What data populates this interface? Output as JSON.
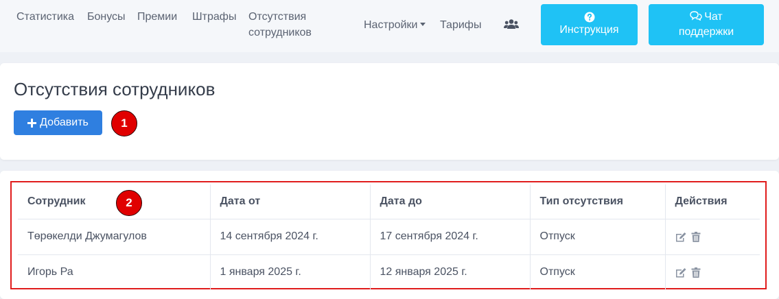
{
  "nav": {
    "items": [
      {
        "label": "Статистика"
      },
      {
        "label": "Бонусы"
      },
      {
        "label": "Премии"
      },
      {
        "label": "Штрафы"
      },
      {
        "label": "Отсутствия сотрудников"
      }
    ],
    "settings_label": "Настройки",
    "tariffs_label": "Тарифы",
    "users_icon": "users-icon",
    "instruction": {
      "label": "Инструкция",
      "icon": "question-circle-icon"
    },
    "chat": {
      "label": "Чат поддержки",
      "icon": "chat-bubbles-icon"
    },
    "accent_color": "#1fc2f5"
  },
  "page": {
    "title": "Отсутствия сотрудников",
    "add_label": "Добавить",
    "add_icon": "plus-icon",
    "primary_color": "#2f7fe0"
  },
  "annotations": {
    "badge_1": "1",
    "badge_2": "2",
    "color": "#e00000"
  },
  "table": {
    "headers": [
      "Сотрудник",
      "Дата от",
      "Дата до",
      "Тип отсутствия",
      "Действия"
    ],
    "rows": [
      {
        "employee": "Төрөкелди Джумагулов",
        "date_from": "14 сентября 2024 г.",
        "date_to": "17 сентября 2024 г.",
        "type": "Отпуск"
      },
      {
        "employee": "Игорь Ра",
        "date_from": "1 января 2025 г.",
        "date_to": "12 января 2025 г.",
        "type": "Отпуск"
      }
    ],
    "action_icons": [
      "edit-icon",
      "trash-icon"
    ]
  }
}
